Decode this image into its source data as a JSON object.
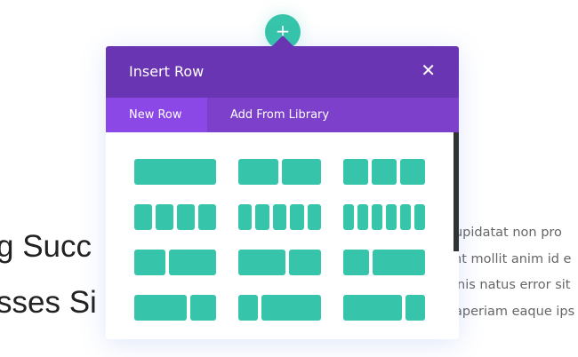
{
  "background": {
    "left_lines": [
      "g Succ",
      "sses Si"
    ],
    "right_lines": [
      "cupidatat non pro",
      "nt mollit anim id e",
      "nis natus error sit",
      "aperiam eaque ips"
    ]
  },
  "add_button": {
    "icon": "plus-icon",
    "label": "+"
  },
  "modal": {
    "title": "Insert Row",
    "close_label": "✕",
    "tabs": [
      {
        "label": "New Row",
        "active": true
      },
      {
        "label": "Add From Library",
        "active": false
      }
    ],
    "layouts": [
      [
        1
      ],
      [
        1,
        1
      ],
      [
        1,
        1,
        1
      ],
      [
        1,
        1,
        1,
        1
      ],
      [
        1,
        1,
        1,
        1,
        1
      ],
      [
        1,
        1,
        1,
        1,
        1,
        1
      ],
      [
        2,
        3
      ],
      [
        3,
        2
      ],
      [
        1,
        2
      ],
      [
        2,
        1
      ],
      [
        1,
        3
      ],
      [
        3,
        1
      ]
    ],
    "accent": "#36c5aa",
    "header_color": "#6a35b3"
  }
}
